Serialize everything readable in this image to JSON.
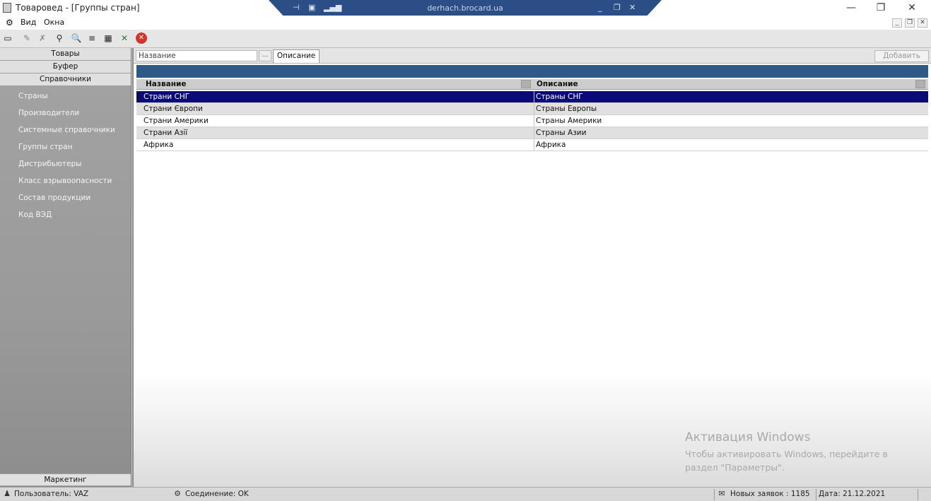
{
  "window": {
    "title": "Товаровед - [Группы стран]",
    "remote_host": "derhach.brocard.ua"
  },
  "menu": {
    "items": [
      "Вид",
      "Окна"
    ]
  },
  "sidebar": {
    "headers": [
      "Товары",
      "Буфер",
      "Справочники"
    ],
    "items": [
      "Страны",
      "Производители",
      "Системные справочники",
      "Группы стран",
      "Дистрибьютеры",
      "Класс взрывоопасности",
      "Состав продукции",
      "Код ВЭД"
    ],
    "footer": "Маркетинг"
  },
  "filter": {
    "name_placeholder": "Название",
    "dots": "...",
    "description_tab": "Описание",
    "add_button": "Добавить"
  },
  "grid": {
    "columns": [
      "Название",
      "Описание"
    ],
    "rows": [
      {
        "name": "Страни СНГ",
        "description": "Страны СНГ"
      },
      {
        "name": "Страни Європи",
        "description": "Страны Европы"
      },
      {
        "name": "Страни Америки",
        "description": "Страны Америки"
      },
      {
        "name": "Страни Азії",
        "description": "Страны Азии"
      },
      {
        "name": "Африка",
        "description": "Африка"
      }
    ]
  },
  "watermark": {
    "title": "Активация Windows",
    "line1": "Чтобы активировать Windows, перейдите в",
    "line2": "раздел \"Параметры\"."
  },
  "status": {
    "user": "Пользователь: VAZ",
    "connection": "Соединение: OK",
    "new_orders": "Новых заявок : 1185",
    "date": "Дата: 21.12.2021"
  },
  "colors": {
    "selected_row": "#0a0a78",
    "blue_bar": "#2e5a8a",
    "rd_bar": "#2b4e86"
  }
}
